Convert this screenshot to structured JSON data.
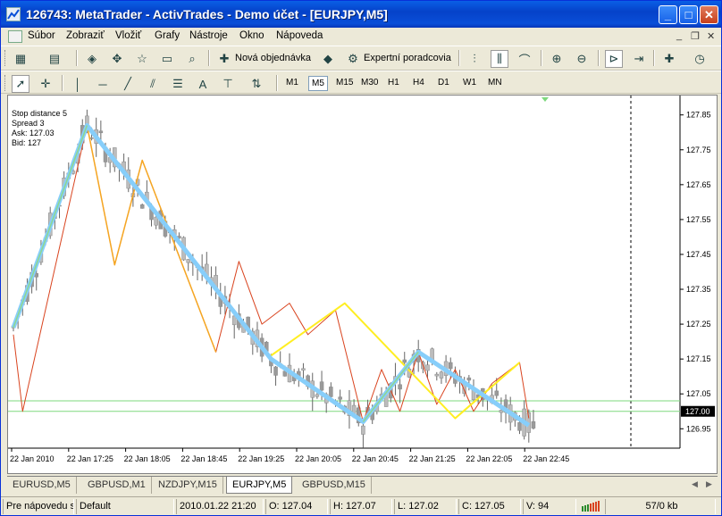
{
  "window": {
    "title": "126743: MetaTrader - ActivTrades - Demo účet - [EURJPY,M5]",
    "min_icon": "minimize-icon",
    "max_icon": "maximize-icon",
    "close_icon": "close-icon"
  },
  "menu": {
    "items": [
      "Súbor",
      "Zobraziť",
      "Vložiť",
      "Grafy",
      "Nástroje",
      "Okno",
      "Nápoveda"
    ]
  },
  "toolbar": {
    "new_order_label": "Nová objednávka",
    "expert_label": "Expertní poradcovia",
    "timeframes": [
      "M1",
      "M5",
      "M15",
      "M30",
      "H1",
      "H4",
      "D1",
      "W1",
      "MN"
    ],
    "active_timeframe": "M5",
    "text_tool_label": "A"
  },
  "chart": {
    "info_lines": [
      "Stop distance 5",
      "Spread 3",
      "Ask: 127.03",
      "Bid: 127"
    ],
    "price_labels": [
      "127.85",
      "127.75",
      "127.65",
      "127.55",
      "127.45",
      "127.35",
      "127.25",
      "127.15",
      "127.05",
      "127.00",
      "126.95"
    ],
    "current_price": "127.00",
    "time_labels": [
      "22 Jan 2010",
      "22 Jan 17:25",
      "22 Jan 18:05",
      "22 Jan 18:45",
      "22 Jan 19:25",
      "22 Jan 20:05",
      "22 Jan 20:45",
      "22 Jan 21:25",
      "22 Jan 22:05",
      "22 Jan 22:45"
    ],
    "colors": {
      "bull_candle": "#bcbcbc",
      "bear_candle": "#9a9a9a",
      "zigzag_blue": "#87cefa",
      "zigzag_yellow": "#ffee22",
      "zigzag_orange": "#f5a623",
      "zigzag_red": "#d9431e",
      "zigzag_green": "#8fd88f",
      "level_line": "#7ed87e"
    }
  },
  "tabs": {
    "items": [
      "EURUSD,M5",
      "GBPUSD,M1",
      "NZDJPY,M15",
      "EURJPY,M5",
      "GBPUSD,M15"
    ],
    "active": "EURJPY,M5"
  },
  "status": {
    "help": "Pre nápovedu s",
    "profile": "Default",
    "datetime": "2010.01.22 21:20",
    "open": "O: 127.04",
    "high": "H: 127.07",
    "low": "L: 127.02",
    "close": "C: 127.05",
    "volume": "V: 94",
    "traffic": "57/0 kb"
  },
  "chart_data": {
    "type": "candlestick",
    "symbol": "EURJPY,M5",
    "ylim": [
      126.92,
      127.88
    ],
    "x": [
      "22 Jan 2010",
      "22 Jan 17:25",
      "22 Jan 18:05",
      "22 Jan 18:45",
      "22 Jan 19:25",
      "22 Jan 20:05",
      "22 Jan 20:45",
      "22 Jan 21:25",
      "22 Jan 22:05",
      "22 Jan 22:45"
    ],
    "bid": 127.0,
    "ask": 127.03,
    "zigzag_blue": [
      [
        0,
        127.24
      ],
      [
        16,
        127.82
      ],
      [
        56,
        127.15
      ],
      [
        76,
        126.97
      ],
      [
        88,
        127.17
      ],
      [
        112,
        126.96
      ]
    ],
    "zigzag_yellow": [
      [
        56,
        127.16
      ],
      [
        72,
        127.31
      ],
      [
        96,
        126.98
      ],
      [
        110,
        127.14
      ]
    ]
  }
}
